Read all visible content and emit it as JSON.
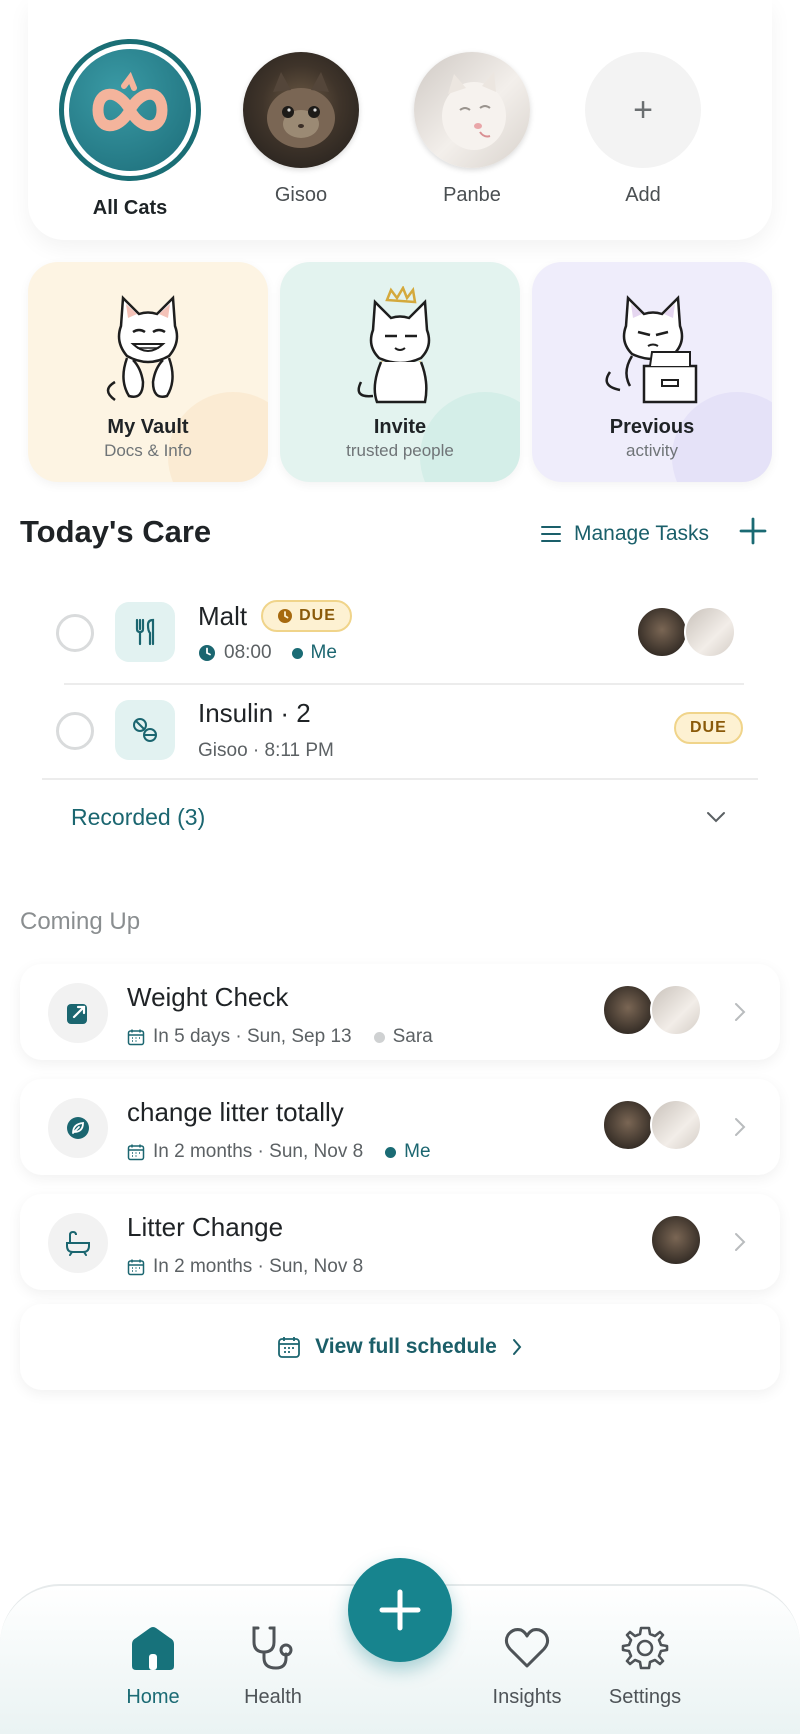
{
  "cats": [
    {
      "name": "All Cats",
      "active": true,
      "avatar": "infinity-logo"
    },
    {
      "name": "Gisoo",
      "active": false,
      "avatar": "tabby-cat-photo"
    },
    {
      "name": "Panbe",
      "active": false,
      "avatar": "white-cat-photo"
    },
    {
      "name": "Add",
      "active": false,
      "avatar": "plus-icon"
    }
  ],
  "quick_cards": [
    {
      "title": "My Vault",
      "subtitle": "Docs & Info",
      "bg": "#fdf4e3",
      "blob": "#fae4c6"
    },
    {
      "title": "Invite",
      "subtitle": "trusted people",
      "bg": "#e3f3ef",
      "blob": "#c9e9e1"
    },
    {
      "title": "Previous",
      "subtitle": "activity",
      "bg": "#efedfb",
      "blob": "#ddd8f6"
    }
  ],
  "todays_care": {
    "title": "Today's Care",
    "manage_label": "Manage Tasks",
    "tasks": [
      {
        "name": "Malt",
        "badge": "DUE",
        "time": "08:00",
        "assignee": "Me",
        "icon": "fork-knife-icon"
      },
      {
        "name": "Insulin · 2",
        "meta": "Gisoo · 8:11 PM",
        "badge": "DUE",
        "icon": "pill-icon"
      }
    ],
    "recorded_label": "Recorded (3)"
  },
  "coming_up": {
    "title": "Coming Up",
    "items": [
      {
        "name": "Weight Check",
        "when": "In 5 days · Sun, Sep 13",
        "assignee": "Sara",
        "assignee_color": "#cfd1d2",
        "icon": "external-edit-icon"
      },
      {
        "name": "change litter totally",
        "when": "In 2 months · Sun, Nov 8",
        "assignee": "Me",
        "assignee_color": "#1a6b74",
        "icon": "leaf-icon"
      },
      {
        "name": "Litter Change",
        "when": "In 2 months · Sun, Nov 8",
        "icon": "bathtub-icon"
      }
    ],
    "view_schedule_label": "View full schedule"
  },
  "nav": {
    "items": [
      {
        "label": "Home",
        "icon": "home-icon",
        "active": true
      },
      {
        "label": "Health",
        "icon": "stethoscope-icon",
        "active": false
      },
      {
        "label": "Insights",
        "icon": "heart-icon",
        "active": false
      },
      {
        "label": "Settings",
        "icon": "gear-icon",
        "active": false
      }
    ]
  },
  "colors": {
    "accent": "#17848e",
    "teal_text": "#1b6670",
    "due_bg": "#fdf1d2",
    "due_border": "#f0d48a"
  }
}
